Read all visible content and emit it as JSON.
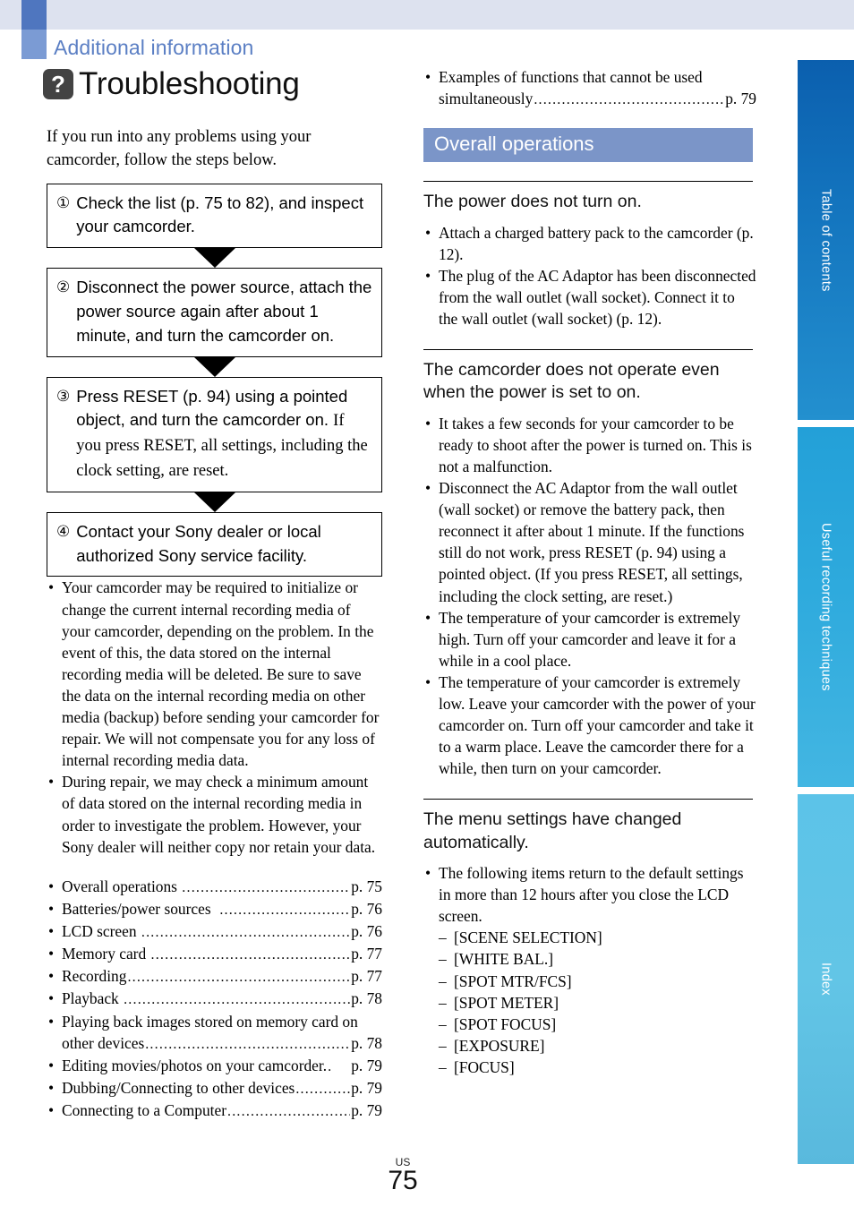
{
  "header": {
    "section_label": "Additional information",
    "chapter_icon": "question-badge-icon",
    "chapter_title": "Troubleshooting"
  },
  "left_column": {
    "intro": "If you run into any problems using your camcorder, follow the steps below.",
    "steps": [
      {
        "number": "①",
        "text": "Check the list (p. 75 to 82), and inspect your camcorder.",
        "note": ""
      },
      {
        "number": "②",
        "text": "Disconnect the power source, attach the power source again after about 1 minute, and turn the camcorder on.",
        "note": ""
      },
      {
        "number": "③",
        "text": "Press RESET (p. 94) using a pointed object, and turn the camcorder on.",
        "note": "If you press RESET, all settings, including the clock setting, are reset."
      },
      {
        "number": "④",
        "text": "Contact your Sony dealer or local authorized Sony service facility.",
        "note": ""
      }
    ],
    "notes": [
      "Your camcorder may be required to initialize or change the current internal recording media of your camcorder, depending on the problem. In the event of this, the data stored on the internal recording media will be deleted. Be sure to save the data on the internal recording media on other media (backup) before sending your camcorder for repair. We will not compensate you for any loss of internal recording media data.",
      "During repair, we may check a minimum amount of data stored on the internal recording media in order to investigate the problem. However, your Sony dealer will neither copy nor retain your data."
    ],
    "toc": [
      {
        "label": "Overall operations ",
        "page": "p. 75",
        "wrap": ""
      },
      {
        "label": "Batteries/power sources  ",
        "page": "p. 76",
        "wrap": ""
      },
      {
        "label": "LCD screen ",
        "page": "p. 76",
        "wrap": ""
      },
      {
        "label": "Memory card ",
        "page": "p. 77",
        "wrap": ""
      },
      {
        "label": "Recording",
        "page": "p. 77",
        "wrap": ""
      },
      {
        "label": "Playback ",
        "page": "p. 78",
        "wrap": ""
      },
      {
        "label": "other devices",
        "page": "p. 78",
        "wrap": "Playing back images stored on memory card on"
      },
      {
        "label": "Editing movies/photos on your camcorder.",
        "page": "p. 79",
        "wrap": ""
      },
      {
        "label": "Dubbing/Connecting to other devices",
        "page": "p. 79",
        "wrap": ""
      },
      {
        "label": "Connecting to a Computer",
        "page": "p. 79",
        "wrap": ""
      }
    ]
  },
  "right_column": {
    "toc_continued": [
      {
        "label": "simultaneously",
        "page": "p. 79",
        "wrap": "Examples of functions that cannot be used"
      }
    ],
    "banner": "Overall operations",
    "qa": [
      {
        "heading": "The power does not turn on.",
        "bullets": [
          "Attach a charged battery pack to the camcorder (p. 12).",
          "The plug of the AC Adaptor has been disconnected from the wall outlet (wall socket). Connect it to the wall outlet (wall socket) (p. 12)."
        ]
      },
      {
        "heading": "The camcorder does not operate even when the power is set to on.",
        "bullets": [
          "It takes a few seconds for your camcorder to be ready to shoot after the power is turned on. This is not a malfunction.",
          "Disconnect the AC Adaptor from the wall outlet (wall socket) or remove the battery pack, then reconnect it after about 1 minute. If the functions still do not work, press RESET (p. 94) using a pointed object. (If you press RESET, all settings, including the clock setting, are reset.)",
          "The temperature of your camcorder is extremely high. Turn off your camcorder and leave it for a while in a cool place.",
          "The temperature of your camcorder is extremely low. Leave your camcorder with the power of your camcorder on. Turn off your camcorder and take it to a warm place. Leave the camcorder there for a while, then turn on your camcorder."
        ]
      },
      {
        "heading": "The menu settings have changed automatically.",
        "bullets": [
          "The following items return to the default settings in more than 12 hours after you close the LCD screen."
        ],
        "sub_items": [
          "[SCENE SELECTION]",
          "[WHITE BAL.]",
          "[SPOT MTR/FCS]",
          "[SPOT METER]",
          "[SPOT FOCUS]",
          "[EXPOSURE]",
          "[FOCUS]"
        ]
      }
    ]
  },
  "side_tabs": [
    {
      "label": "Table of contents"
    },
    {
      "label": "Useful recording techniques"
    },
    {
      "label": "Index"
    }
  ],
  "footer": {
    "region": "US",
    "page_number": "75"
  },
  "colors": {
    "section_label": "#5b7fc4",
    "banner_bg": "#7b95c8",
    "badge_bg": "#434343",
    "top_band": "#dde2ef",
    "square_dark": "#4f76bf",
    "square_light": "#7b9bd4"
  }
}
